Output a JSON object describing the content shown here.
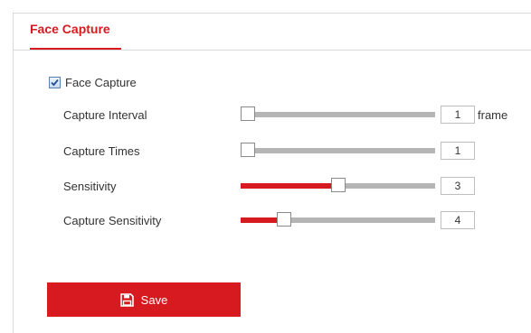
{
  "tabs": [
    {
      "label": "Face Capture",
      "active": true
    }
  ],
  "face_capture": {
    "checkbox_label": "Face Capture",
    "checked": true
  },
  "settings": [
    {
      "label": "Capture Interval",
      "value": "1",
      "unit": "frame",
      "level": 0.0
    },
    {
      "label": "Capture Times",
      "value": "1",
      "unit": "",
      "level": 0.0
    },
    {
      "label": "Sensitivity",
      "value": "3",
      "unit": "",
      "level": 0.5
    },
    {
      "label": "Capture Sensitivity",
      "value": "4",
      "unit": "",
      "level": 0.2
    }
  ],
  "actions": {
    "save_label": "Save"
  },
  "colors": {
    "accent": "#d71920",
    "track": "#b5b5b5"
  },
  "icons": {
    "save": "floppy-disk-icon",
    "checkbox": "checkmark-icon"
  }
}
